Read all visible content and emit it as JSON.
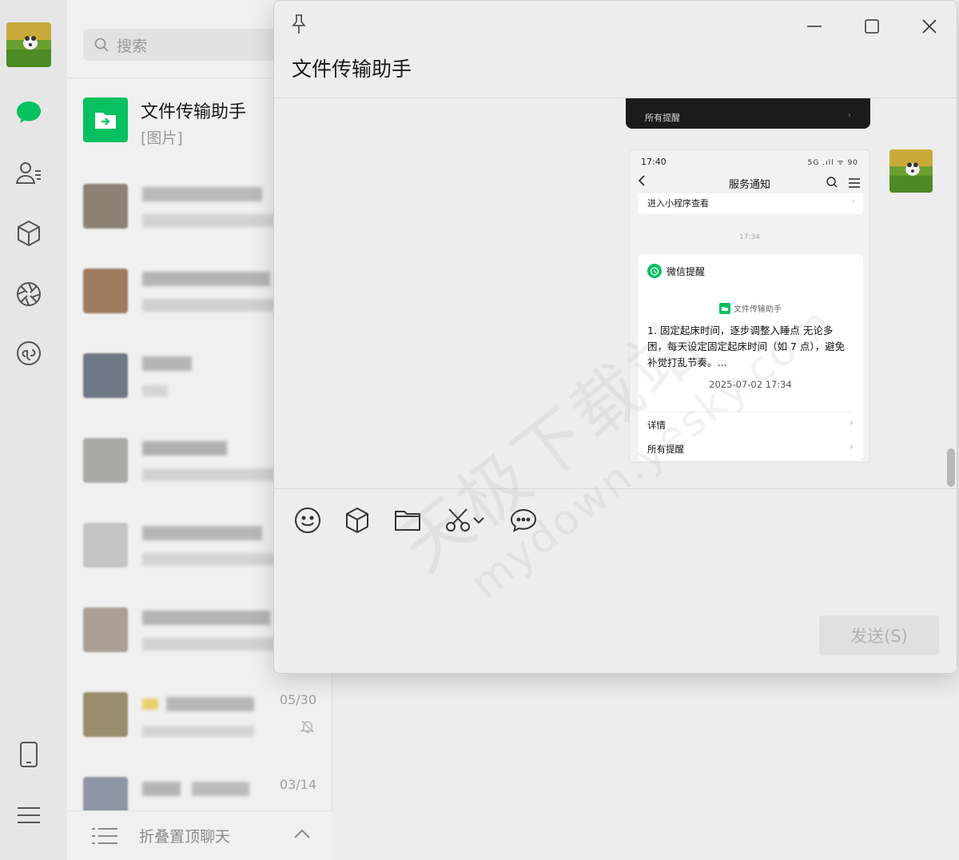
{
  "search": {
    "placeholder": "搜索"
  },
  "chat_list": {
    "active": {
      "name": "文件传输助手",
      "preview": "[图片]"
    },
    "items": [
      {
        "time": ""
      },
      {
        "time": ""
      },
      {
        "time": ""
      },
      {
        "time": ""
      },
      {
        "time": ""
      },
      {
        "time": ""
      },
      {
        "time": "05/30",
        "muted": true
      },
      {
        "time": "03/14"
      }
    ],
    "fold_label": "折叠置顶聊天"
  },
  "window": {
    "title": "文件传输助手",
    "send_label": "发送(S)"
  },
  "messages": {
    "dark_card_label": "所有提醒",
    "screenshot": {
      "status_time": "17:40",
      "status_right": "5G .ıll ᯤ 90",
      "nav_title": "服务通知",
      "strip_text": "进入小程序查看",
      "timestamp": "17:34",
      "card_sender": "微信提醒",
      "card_source": "文件传输助手",
      "card_body": "1. 固定起床时间，逐步调整入睡点 无论多困，每天设定固定起床时间（如 7 点），避免补觉打乱节奏。...",
      "card_date": "2025-07-02 17:34",
      "row_details": "详情",
      "row_all": "所有提醒"
    }
  },
  "watermark": {
    "line1": "天极下载站",
    "line2": "mydown.yesky.com"
  },
  "colors": {
    "accent": "#07c160",
    "rail_bg": "#e6e6e6",
    "list_bg": "#f0f0f0",
    "window_bg": "#ededed"
  }
}
